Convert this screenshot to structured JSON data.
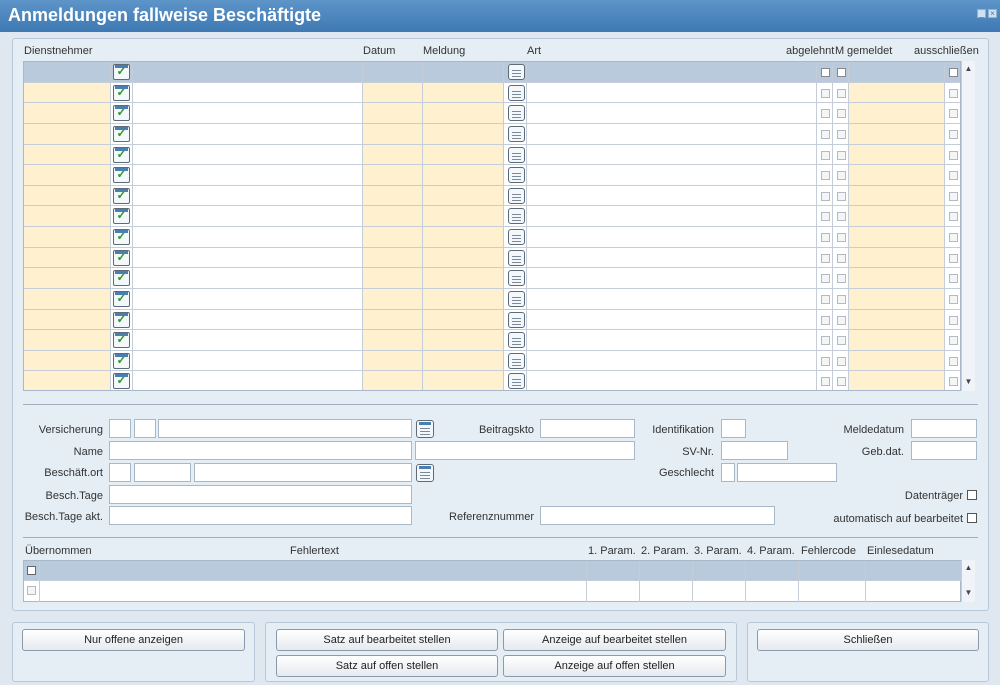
{
  "window": {
    "title": "Anmeldungen fallweise Beschäftigte"
  },
  "grid": {
    "headers": {
      "dienstnehmer": "Dienstnehmer",
      "datum": "Datum",
      "meldung": "Meldung",
      "art": "Art",
      "abgelehnt": "abgelehnt",
      "m": "M",
      "gemeldet": "gemeldet",
      "ausschliessen": "ausschließen"
    },
    "row_count": 16
  },
  "form": {
    "versicherung_label": "Versicherung",
    "name_label": "Name",
    "beschaeftort_label": "Beschäft.ort",
    "besch_tage_label": "Besch.Tage",
    "besch_tage_akt_label": "Besch.Tage akt.",
    "beitragskto_label": "Beitragskto",
    "referenznummer_label": "Referenznummer",
    "identifikation_label": "Identifikation",
    "svnr_label": "SV-Nr.",
    "geschlecht_label": "Geschlecht",
    "meldedatum_label": "Meldedatum",
    "gebdat_label": "Geb.dat.",
    "datentraeger_label": "Datenträger",
    "automatisch_label": "automatisch auf bearbeitet"
  },
  "errors": {
    "headers": {
      "uebernommen": "Übernommen",
      "fehlertext": "Fehlertext",
      "p1": "1. Param.",
      "p2": "2. Param.",
      "p3": "3. Param.",
      "p4": "4. Param.",
      "fehlercode": "Fehlercode",
      "einlesedatum": "Einlesedatum"
    }
  },
  "buttons": {
    "nur_offene": "Nur offene anzeigen",
    "satz_bearbeitet": "Satz auf bearbeitet stellen",
    "anzeige_bearbeitet": "Anzeige auf bearbeitet stellen",
    "satz_offen": "Satz auf offen stellen",
    "anzeige_offen": "Anzeige auf offen stellen",
    "schliessen": "Schließen"
  },
  "colors": {
    "titlebar": "#3e79b3",
    "editable_cell": "#fff0cf",
    "panel": "#e5edf5"
  }
}
